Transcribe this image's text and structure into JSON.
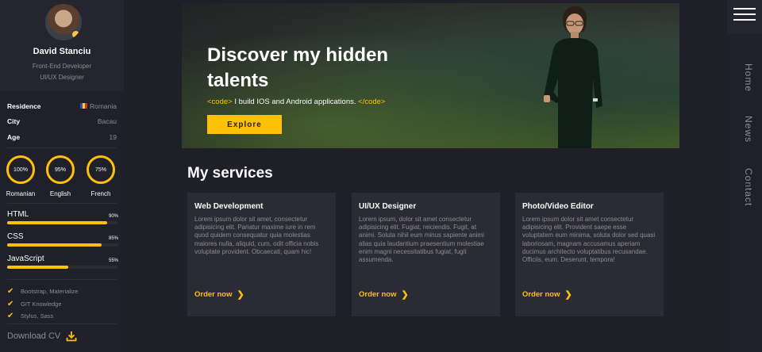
{
  "profile": {
    "name": "David Stanciu",
    "role_line1": "Front-End Developer",
    "role_line2": "UI/UX Designer"
  },
  "info": [
    {
      "key": "Residence",
      "value": "Romania",
      "flag": true
    },
    {
      "key": "City",
      "value": "Bacau"
    },
    {
      "key": "Age",
      "value": "19"
    }
  ],
  "languages": [
    {
      "label": "Romanian",
      "percent": "100%"
    },
    {
      "label": "English",
      "percent": "95%"
    },
    {
      "label": "French",
      "percent": "75%"
    }
  ],
  "skills": [
    {
      "name": "HTML",
      "percent_label": "90%",
      "level": 0.9
    },
    {
      "name": "CSS",
      "percent_label": "85%",
      "level": 0.85
    },
    {
      "name": "JavaScript",
      "percent_label": "55%",
      "level": 0.55
    }
  ],
  "extras": [
    "Bootstrap, Materialize",
    "GIT Knowledge",
    "Stylus, Sass"
  ],
  "download_label": "Download CV",
  "hero": {
    "title": "Discover my hidden talents",
    "code_open": "<code>",
    "subtitle": " I build IOS and Android applications. ",
    "code_close": "</code>",
    "button": "Explore"
  },
  "services": {
    "title": "My services",
    "cards": [
      {
        "title": "Web Development",
        "text": "Lorem ipsum dolor sit amet, consectetur adipisicing elit. Pariatur maxime iure in rem quod quidem consequatur quia molestias maiores nulla, aliquid, cum, odit officia nobis voluptate provident. Obcaecati, quam hic!",
        "link": "Order now"
      },
      {
        "title": "UI/UX Designer",
        "text": "Lorem ipsum, dolor sit amet consectetur adipisicing elit. Fugiat, reiciendis. Fugit, at animi. Soluta nihil eum minus sapiente animi alias quia laudantium praesentium molestiae enim magni necessitatibus fugiat, fugit assumenda.",
        "link": "Order now"
      },
      {
        "title": "Photo/Video Editor",
        "text": "Lorem ipsum dolor sit amet consectetur adipisicing elit. Provident saepe esse voluptatem eum minima, soluta dolor sed quasi laboriosam, magnam accusamus aperiam ducimus architecto voluptatibus recusandae. Officiis, eum. Deserunt, tempora!",
        "link": "Order now"
      }
    ]
  },
  "nav": [
    "Home",
    "News",
    "Contact"
  ],
  "colors": {
    "accent": "#ffc107",
    "background": "#1f1f27",
    "card": "#2b2b35",
    "muted_text": "#8c8c8e"
  }
}
